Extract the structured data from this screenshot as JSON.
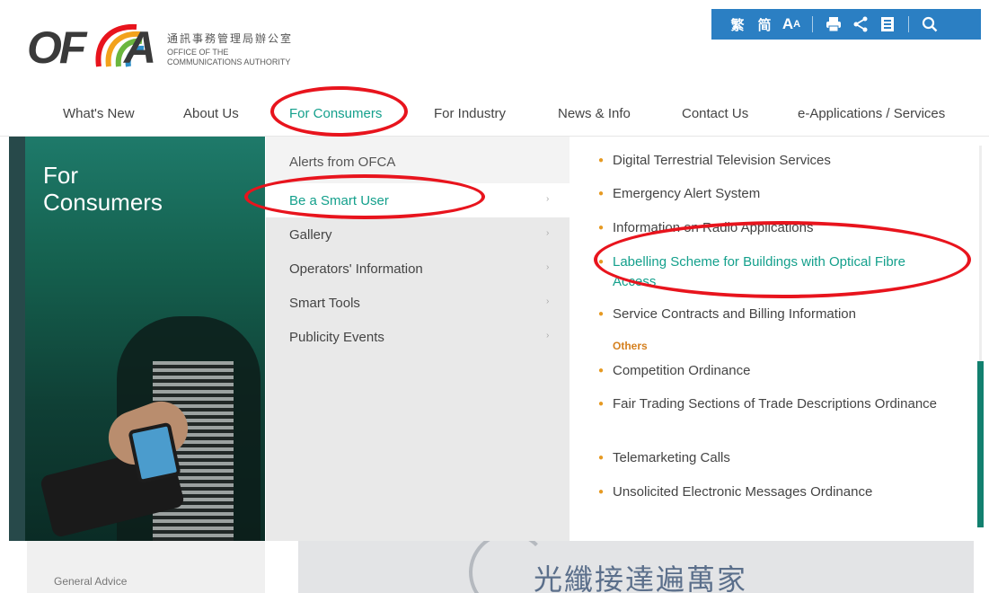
{
  "logo": {
    "mark": "OF",
    "mark_a": "A",
    "chinese_name": "通訊事務管理局辦公室",
    "english_line1": "OFFICE OF THE",
    "english_line2": "COMMUNICATIONS AUTHORITY"
  },
  "toolbar": {
    "traditional_chinese": "繁",
    "simplified_chinese": "简",
    "font_size": "A"
  },
  "nav": {
    "items": [
      "What's New",
      "About Us",
      "For Consumers",
      "For Industry",
      "News & Info",
      "Contact Us",
      "e-Applications / Services"
    ],
    "active": "For Consumers"
  },
  "menu": {
    "section_title_line1": "For",
    "section_title_line2": "Consumers",
    "level2": [
      {
        "label": "Alerts from OFCA",
        "has_children": false
      },
      {
        "label": "Be a Smart User",
        "has_children": true,
        "active": true
      },
      {
        "label": "Gallery",
        "has_children": true
      },
      {
        "label": "Operators' Information",
        "has_children": true
      },
      {
        "label": "Smart Tools",
        "has_children": true
      },
      {
        "label": "Publicity Events",
        "has_children": true
      }
    ],
    "level3": [
      {
        "label": "Digital Terrestrial Television Services"
      },
      {
        "label": "Emergency Alert System"
      },
      {
        "label": "Information on Radio Applications"
      },
      {
        "label": "Labelling Scheme for Buildings with Optical Fibre Access",
        "highlighted": true
      },
      {
        "label": "Service Contracts and Billing Information"
      }
    ],
    "others_heading": "Others",
    "others": [
      {
        "label": "Competition Ordinance"
      },
      {
        "label": "Fair Trading Sections of Trade Descriptions Ordinance"
      },
      {
        "label": "Telemarketing Calls"
      },
      {
        "label": "Unsolicited Electronic Messages Ordinance"
      }
    ]
  },
  "below": {
    "general_advice": "General Advice",
    "banner_text": "光纖接達遍萬家"
  },
  "colors": {
    "accent": "#14a08c",
    "toolbar": "#2b7fc3",
    "bullet": "#e69a23",
    "annotation": "#e8141d"
  }
}
